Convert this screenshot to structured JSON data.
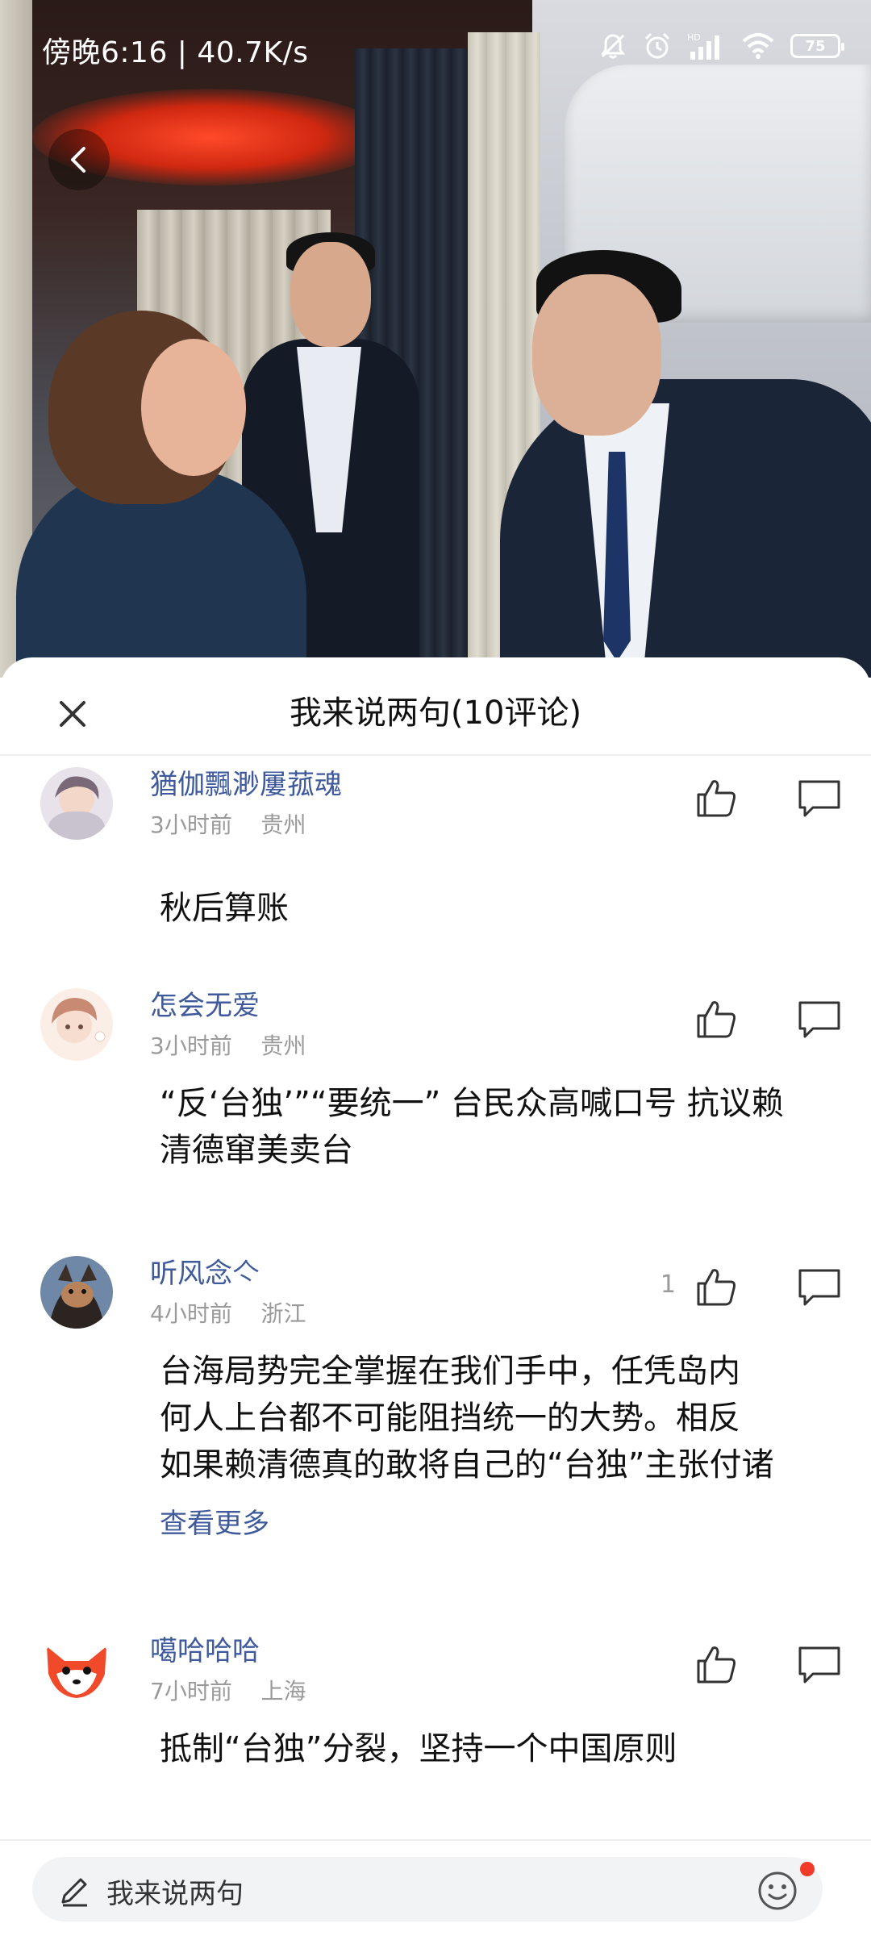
{
  "status_bar": {
    "time_speed": "傍晚6:16 | 40.7K/s",
    "battery_level": "75",
    "icons": [
      "mute-bell-icon",
      "alarm-icon",
      "hd-signal-icon",
      "wifi-icon",
      "battery-icon"
    ]
  },
  "photo": {
    "icons": [
      "back-arrow-icon"
    ]
  },
  "sheet": {
    "title": "我来说两句(10评论)",
    "close_icon": "close-icon"
  },
  "comments": [
    {
      "username": "猶伽飄渺屢菰魂",
      "time": "3小时前",
      "location": "贵州",
      "likes": "",
      "text_lines": [
        "秋后算账"
      ],
      "see_more": ""
    },
    {
      "username": "怎会无爱",
      "time": "3小时前",
      "location": "贵州",
      "likes": "",
      "text_lines": [
        "“反‘台独’”“要统一” 台民众高喊口号 抗议赖",
        "清德窜美卖台"
      ],
      "see_more": ""
    },
    {
      "username": "听风念亽",
      "time": "4小时前",
      "location": "浙江",
      "likes": "1",
      "text_lines": [
        "台海局势完全掌握在我们手中，任凭岛内",
        "何人上台都不可能阻挡统一的大势。相反",
        "如果赖清德真的敢将自己的“台独”主张付诸"
      ],
      "see_more": "查看更多"
    },
    {
      "username": "噶哈哈哈",
      "time": "7小时前",
      "location": "上海",
      "likes": "",
      "text_lines": [
        "抵制“台独”分裂，坚持一个中国原则"
      ],
      "see_more": ""
    }
  ],
  "input_bar": {
    "placeholder": "我来说两句",
    "accent_dot_color": "#f03a2a"
  },
  "colors": {
    "username": "#3e5a9c",
    "meta": "#9a9a9a",
    "text": "#111111"
  }
}
